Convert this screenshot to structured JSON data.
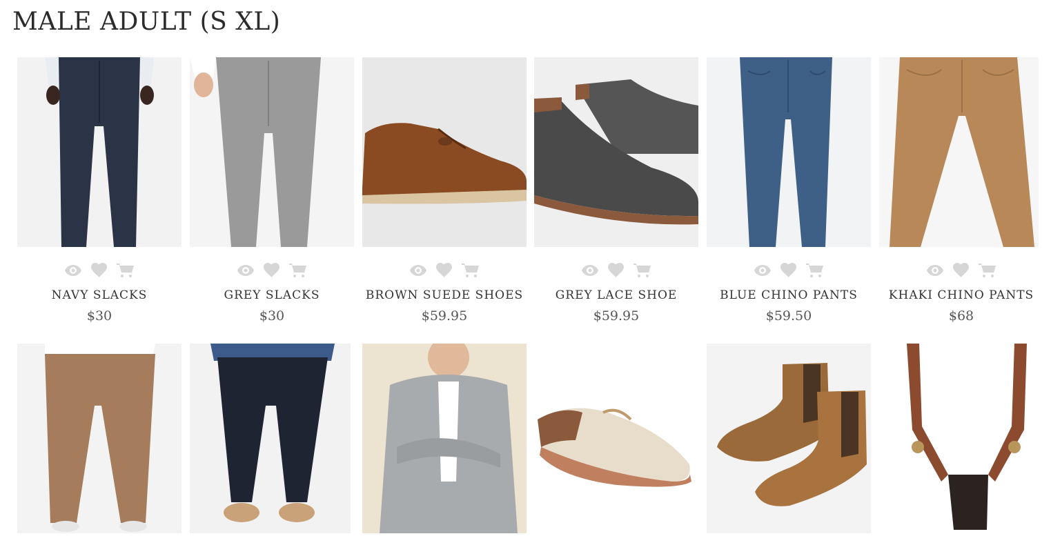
{
  "page": {
    "title": "MALE ADULT (S XL)"
  },
  "action_icons": [
    "eye-icon",
    "heart-icon",
    "cart-icon"
  ],
  "products": [
    {
      "name": "NAVY SLACKS",
      "price": "$30",
      "image": "navy-slacks"
    },
    {
      "name": "GREY SLACKS",
      "price": "$30",
      "image": "grey-slacks"
    },
    {
      "name": "BROWN SUEDE SHOES",
      "price": "$59.95",
      "image": "brown-suede-shoes"
    },
    {
      "name": "GREY LACE SHOE",
      "price": "$59.95",
      "image": "grey-lace-shoe"
    },
    {
      "name": "BLUE CHINO PANTS",
      "price": "$59.50",
      "image": "blue-chino-pants"
    },
    {
      "name": "KHAKI CHINO PANTS",
      "price": "$68",
      "image": "khaki-chino-pants"
    }
  ],
  "row2_images": [
    "tan-chinos",
    "navy-jeans-loafers",
    "grey-cardigan",
    "boat-shoe",
    "chelsea-boots",
    "leather-suspenders"
  ],
  "colors": {
    "icon_gray": "#d6d6d6",
    "navy": "#2b3346",
    "grey_slack": "#9a9a9a",
    "suede": "#8a4a22",
    "charcoal": "#4a4a4a",
    "blue_chino": "#3e5f86",
    "khaki": "#b88858",
    "tan": "#a57d5c",
    "leather": "#8c4b2e"
  }
}
